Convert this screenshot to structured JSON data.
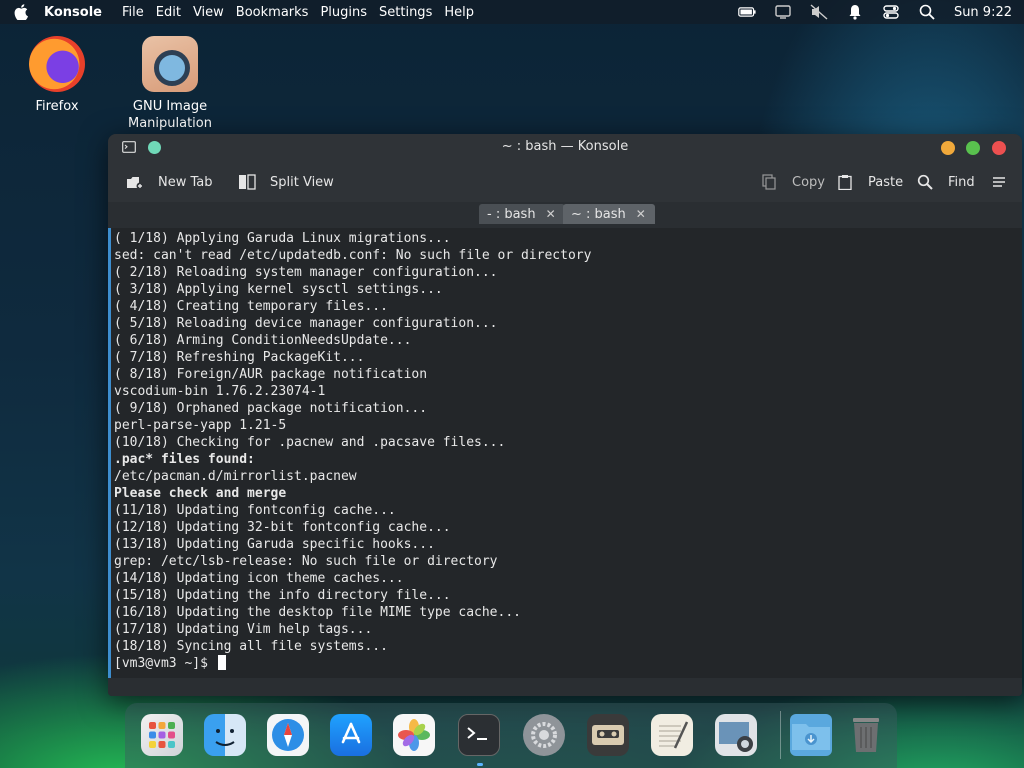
{
  "menubar": {
    "app_name": "Konsole",
    "items": [
      "File",
      "Edit",
      "View",
      "Bookmarks",
      "Plugins",
      "Settings",
      "Help"
    ],
    "clock": "Sun 9:22"
  },
  "desktop": {
    "icons": [
      {
        "label": "Firefox"
      },
      {
        "label": "GNU Image Manipulation ..."
      }
    ]
  },
  "window": {
    "title": "~ : bash — Konsole",
    "toolbar": {
      "new_tab": "New Tab",
      "split_view": "Split View",
      "copy": "Copy",
      "paste": "Paste",
      "find": "Find"
    },
    "tabs": [
      {
        "label": "- : bash"
      },
      {
        "label": "~ : bash"
      }
    ]
  },
  "terminal": {
    "lines": [
      "( 1/18) Applying Garuda Linux migrations...",
      "sed: can't read /etc/updatedb.conf: No such file or directory",
      "( 2/18) Reloading system manager configuration...",
      "( 3/18) Applying kernel sysctl settings...",
      "( 4/18) Creating temporary files...",
      "( 5/18) Reloading device manager configuration...",
      "( 6/18) Arming ConditionNeedsUpdate...",
      "( 7/18) Refreshing PackageKit...",
      "( 8/18) Foreign/AUR package notification",
      "vscodium-bin 1.76.2.23074-1",
      "( 9/18) Orphaned package notification...",
      "perl-parse-yapp 1.21-5",
      "(10/18) Checking for .pacnew and .pacsave files...",
      ".pac* files found:",
      "/etc/pacman.d/mirrorlist.pacnew",
      "Please check and merge",
      "(11/18) Updating fontconfig cache...",
      "(12/18) Updating 32-bit fontconfig cache...",
      "(13/18) Updating Garuda specific hooks...",
      "grep: /etc/lsb-release: No such file or directory",
      "(14/18) Updating icon theme caches...",
      "(15/18) Updating the info directory file...",
      "(16/18) Updating the desktop file MIME type cache...",
      "(17/18) Updating Vim help tags...",
      "(18/18) Syncing all file systems..."
    ],
    "prompt": "[vm3@vm3 ~]$ "
  },
  "dock": {
    "items": [
      "launchpad-icon",
      "finder-icon",
      "safari-icon",
      "app-store-icon",
      "photos-icon",
      "terminal-icon",
      "system-settings-icon",
      "cassette-icon",
      "text-editor-icon",
      "screenshot-icon",
      "downloads-folder-icon",
      "trash-icon"
    ]
  }
}
